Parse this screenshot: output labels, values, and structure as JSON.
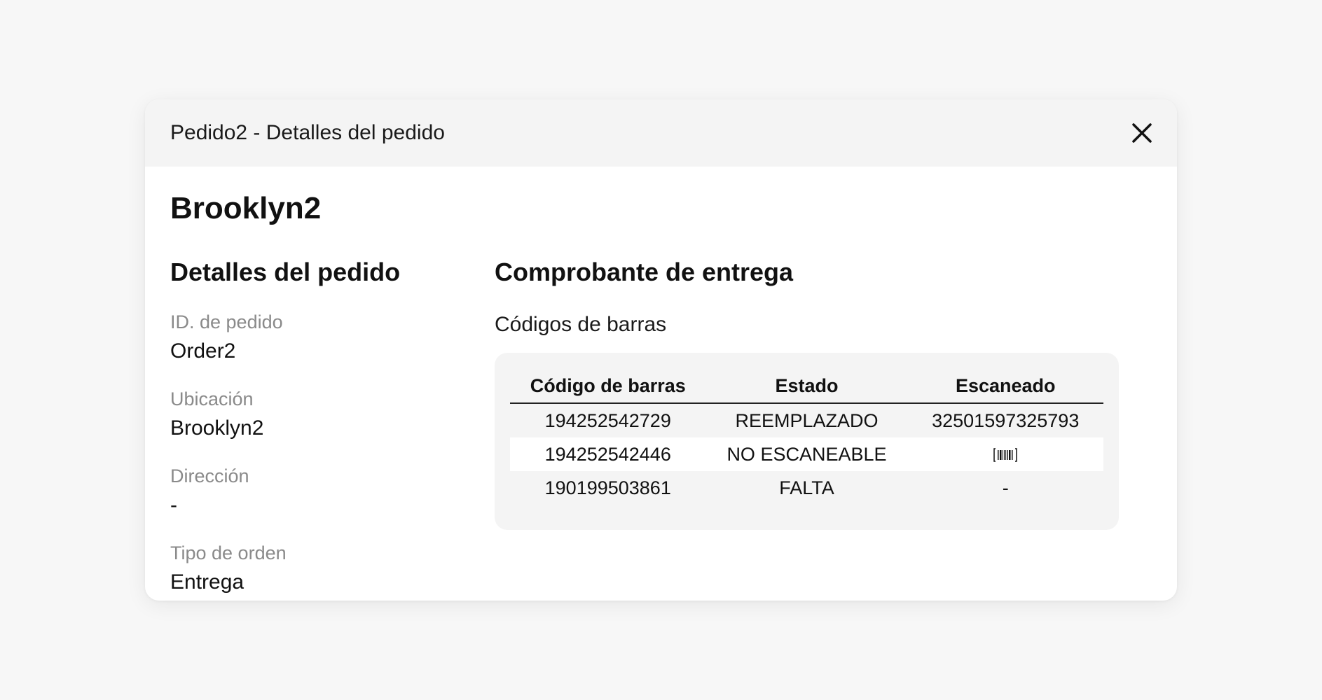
{
  "modal": {
    "title": "Pedido2 - Detalles del pedido",
    "close_icon": "close-icon"
  },
  "store_name": "Brooklyn2",
  "order_details": {
    "title": "Detalles del pedido",
    "fields": [
      {
        "label": "ID. de pedido",
        "value": "Order2"
      },
      {
        "label": "Ubicación",
        "value": "Brooklyn2"
      },
      {
        "label": "Dirección",
        "value": "-"
      },
      {
        "label": "Tipo de orden",
        "value": "Entrega"
      }
    ]
  },
  "proof_of_delivery": {
    "title": "Comprobante de entrega",
    "barcodes_title": "Códigos de barras",
    "columns": [
      "Código de barras",
      "Estado",
      "Escaneado"
    ],
    "rows": [
      {
        "barcode": "194252542729",
        "status": "REEMPLAZADO",
        "scanned": "32501597325793",
        "scanned_icon": null
      },
      {
        "barcode": "194252542446",
        "status": "NO ESCANEABLE",
        "scanned": "",
        "scanned_icon": "barcode-scan-icon"
      },
      {
        "barcode": "190199503861",
        "status": "FALTA",
        "scanned": "-",
        "scanned_icon": null
      }
    ]
  }
}
